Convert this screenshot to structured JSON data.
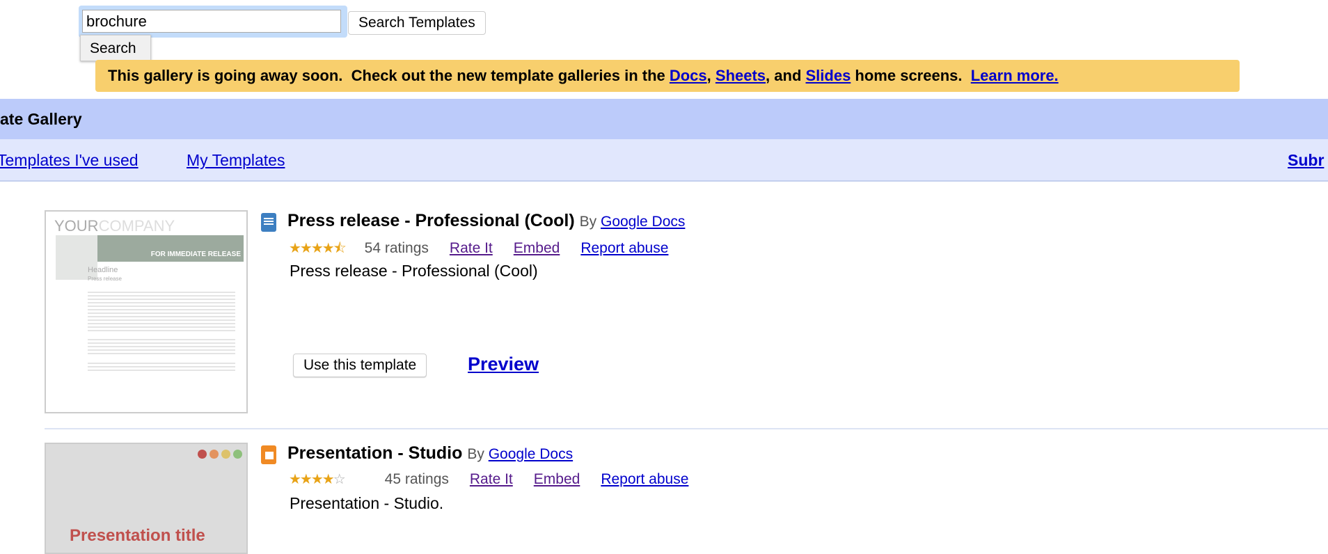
{
  "search": {
    "value": "brochure",
    "button_label": "Search Templates",
    "suggestion": "Search"
  },
  "banner": {
    "text_before": "This gallery is going away soon.  Check out the new template galleries in the ",
    "link_docs": "Docs",
    "sep1": ", ",
    "link_sheets": "Sheets",
    "sep2": ", and ",
    "link_slides": "Slides",
    "text_after": " home screens.  ",
    "learn_more": "Learn more."
  },
  "header": {
    "title": "ate Gallery"
  },
  "nav": {
    "templates_used": "Templates I've used",
    "my_templates": "My Templates",
    "submit": "Subr"
  },
  "templates": [
    {
      "title": "Press release - Professional (Cool)",
      "by_label": "By",
      "author": "Google Docs",
      "rating": 4.5,
      "ratings": "54 ratings",
      "rate": "Rate It",
      "embed": "Embed",
      "report": "Report abuse",
      "description": "Press release - Professional (Cool)",
      "use_label": "Use this template",
      "preview_label": "Preview",
      "type_icon": "document-icon",
      "icon_color": "#3d7fc1",
      "thumb": {
        "company_a": "YOUR",
        "company_b": "COMPANY",
        "release": "FOR IMMEDIATE RELEASE",
        "headline": "Headline",
        "sub": "Press release"
      }
    },
    {
      "title": "Presentation - Studio",
      "by_label": "By",
      "author": "Google Docs",
      "rating": 4,
      "ratings": "45 ratings",
      "rate": "Rate It",
      "embed": "Embed",
      "report": "Report abuse",
      "description": "Presentation - Studio.",
      "type_icon": "presentation-icon",
      "icon_color": "#f08a24",
      "thumb": {
        "title": "Presentation title"
      }
    }
  ]
}
